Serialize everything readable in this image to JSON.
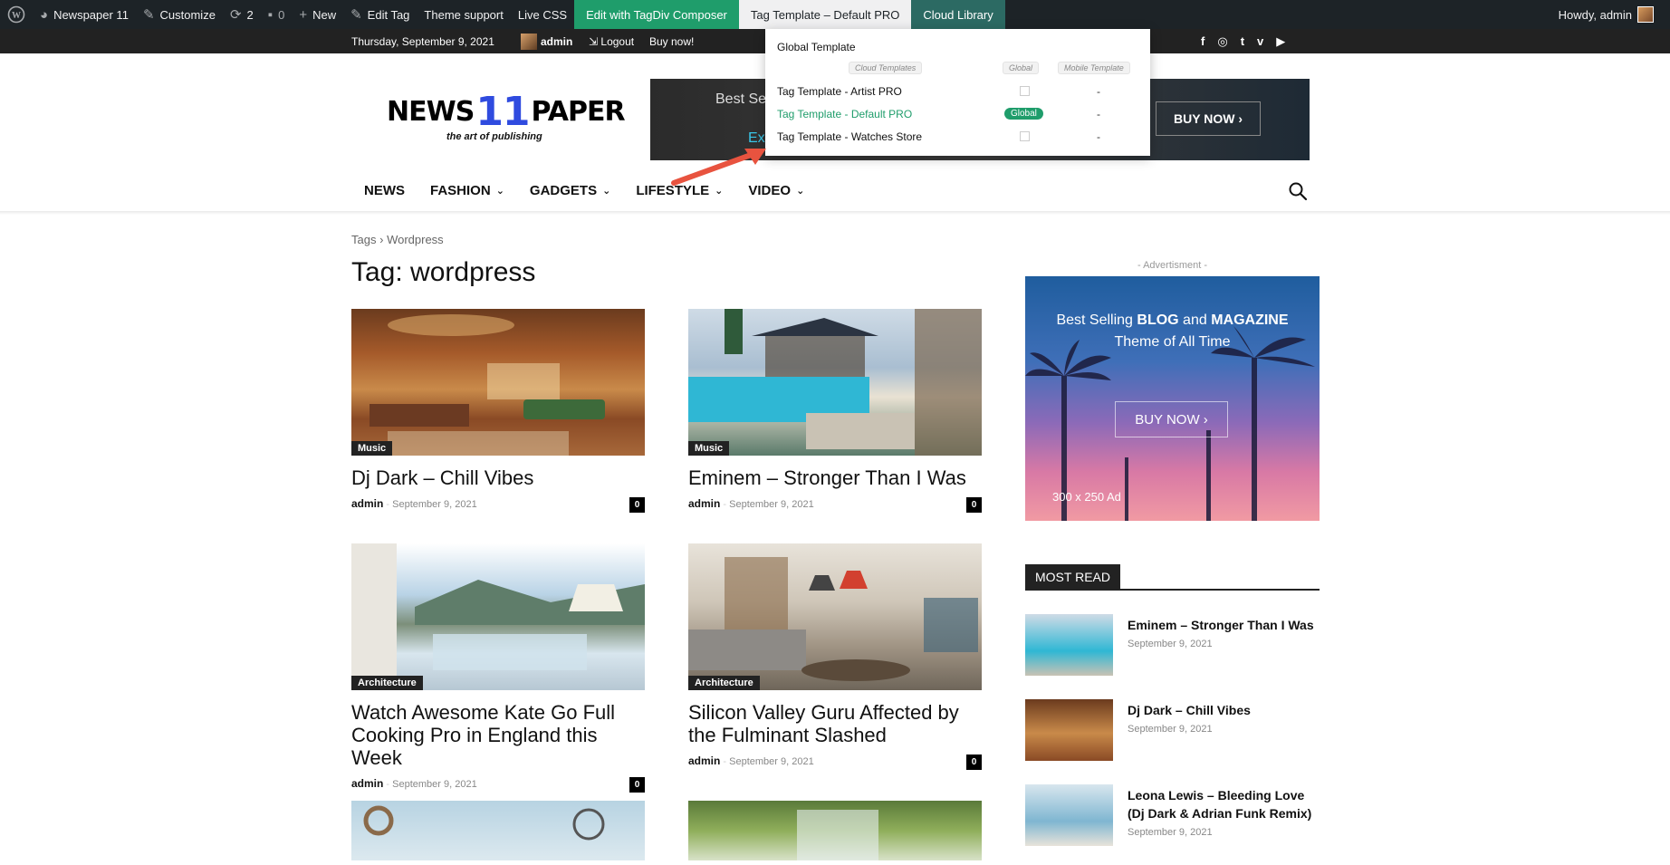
{
  "adminbar": {
    "site_name": "Newspaper 11",
    "customize": "Customize",
    "updates": "2",
    "comments": "0",
    "new": "New",
    "edit_tag": "Edit Tag",
    "theme_support": "Theme support",
    "live_css": "Live CSS",
    "edit_composer": "Edit with TagDiv Composer",
    "tag_template": "Tag Template – Default PRO",
    "cloud_library": "Cloud Library",
    "howdy": "Howdy, admin"
  },
  "topbar": {
    "date": "Thursday, September 9, 2021",
    "user": "admin",
    "logout": "Logout",
    "buy_now": "Buy now!",
    "socials": [
      "f",
      "◎",
      "t",
      "v",
      "▶"
    ]
  },
  "logo": {
    "word1": "NEWS",
    "number": "11",
    "word2": "PAPER",
    "tagline": "the art of publishing"
  },
  "header_banner": {
    "text1": "Best Se",
    "text2": "Ex",
    "button": "BUY NOW ›"
  },
  "dropdown": {
    "global_template": "Global Template",
    "col_cloud": "Cloud Templates",
    "col_global": "Global",
    "col_mobile": "Mobile Template",
    "rows": [
      {
        "name": "Tag Template - Artist PRO",
        "mobile": "-"
      },
      {
        "name": "Tag Template - Default PRO",
        "global_badge": "Global",
        "mobile": "-"
      },
      {
        "name": "Tag Template - Watches Store",
        "mobile": "-"
      }
    ]
  },
  "nav": {
    "items": [
      "NEWS",
      "FASHION",
      "GADGETS",
      "LIFESTYLE",
      "VIDEO"
    ]
  },
  "breadcrumb": {
    "root": "Tags",
    "sep": "›",
    "current": "Wordpress"
  },
  "page_title": "Tag: wordpress",
  "posts": [
    {
      "category": "Music",
      "title": "Dj Dark – Chill Vibes",
      "author": "admin",
      "date": "September 9, 2021",
      "comments": "0"
    },
    {
      "category": "Music",
      "title": "Eminem – Stronger Than I Was",
      "author": "admin",
      "date": "September 9, 2021",
      "comments": "0"
    },
    {
      "category": "Architecture",
      "title": "Watch Awesome Kate Go Full Cooking Pro in England this Week",
      "author": "admin",
      "date": "September 9, 2021",
      "comments": "0"
    },
    {
      "category": "Architecture",
      "title": "Silicon Valley Guru Affected by the Fulminant Slashed",
      "author": "admin",
      "date": "September 9, 2021",
      "comments": "0"
    }
  ],
  "sidebar": {
    "advert_label": "- Advertisment -",
    "ad_line1_pre": "Best Selling ",
    "ad_line1_b1": "BLOG",
    "ad_line1_mid": " and ",
    "ad_line1_b2": "MAGAZINE",
    "ad_line2": "Theme of All Time",
    "ad_button": "BUY NOW ›",
    "ad_size": "300 x 250 Ad",
    "most_read": "MOST READ",
    "items": [
      {
        "title": "Eminem – Stronger Than I Was",
        "date": "September 9, 2021"
      },
      {
        "title": "Dj Dark – Chill Vibes",
        "date": "September 9, 2021"
      },
      {
        "title": "Leona Lewis – Bleeding Love (Dj Dark & Adrian Funk Remix)",
        "date": "September 9, 2021"
      }
    ]
  },
  "colors": {
    "accent_green": "#1f9d6b",
    "logo_blue": "#2f4bdf",
    "adminbar_bg": "#1d2327"
  }
}
